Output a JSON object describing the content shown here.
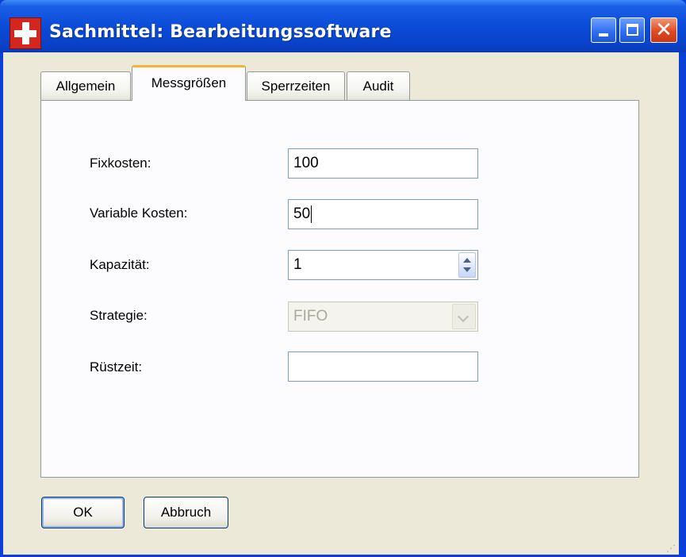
{
  "window": {
    "title": "Sachmittel: Bearbeitungssoftware",
    "icons": {
      "app": "red-cross-icon",
      "minimize": "minimize-icon",
      "maximize": "maximize-icon",
      "close": "close-icon"
    },
    "close_glyph": "✕"
  },
  "tabs": [
    {
      "label": "Allgemein",
      "active": false
    },
    {
      "label": "Messgrößen",
      "active": true
    },
    {
      "label": "Sperrzeiten",
      "active": false
    },
    {
      "label": "Audit",
      "active": false
    }
  ],
  "form": {
    "fixkosten": {
      "label": "Fixkosten:",
      "value": "100"
    },
    "variable_kosten": {
      "label": "Variable Kosten:",
      "value": "50"
    },
    "kapazitaet": {
      "label": "Kapazität:",
      "value": "1"
    },
    "strategie": {
      "label": "Strategie:",
      "value": "FIFO",
      "enabled": false
    },
    "ruestzeit": {
      "label": "Rüstzeit:",
      "value": ""
    }
  },
  "buttons": {
    "ok": "OK",
    "cancel": "Abbruch"
  },
  "colors": {
    "titlebar": "#0b4bd8",
    "client_bg": "#ece9d8",
    "active_tab_accent": "#f7b23a",
    "close_button": "#e04a22"
  }
}
